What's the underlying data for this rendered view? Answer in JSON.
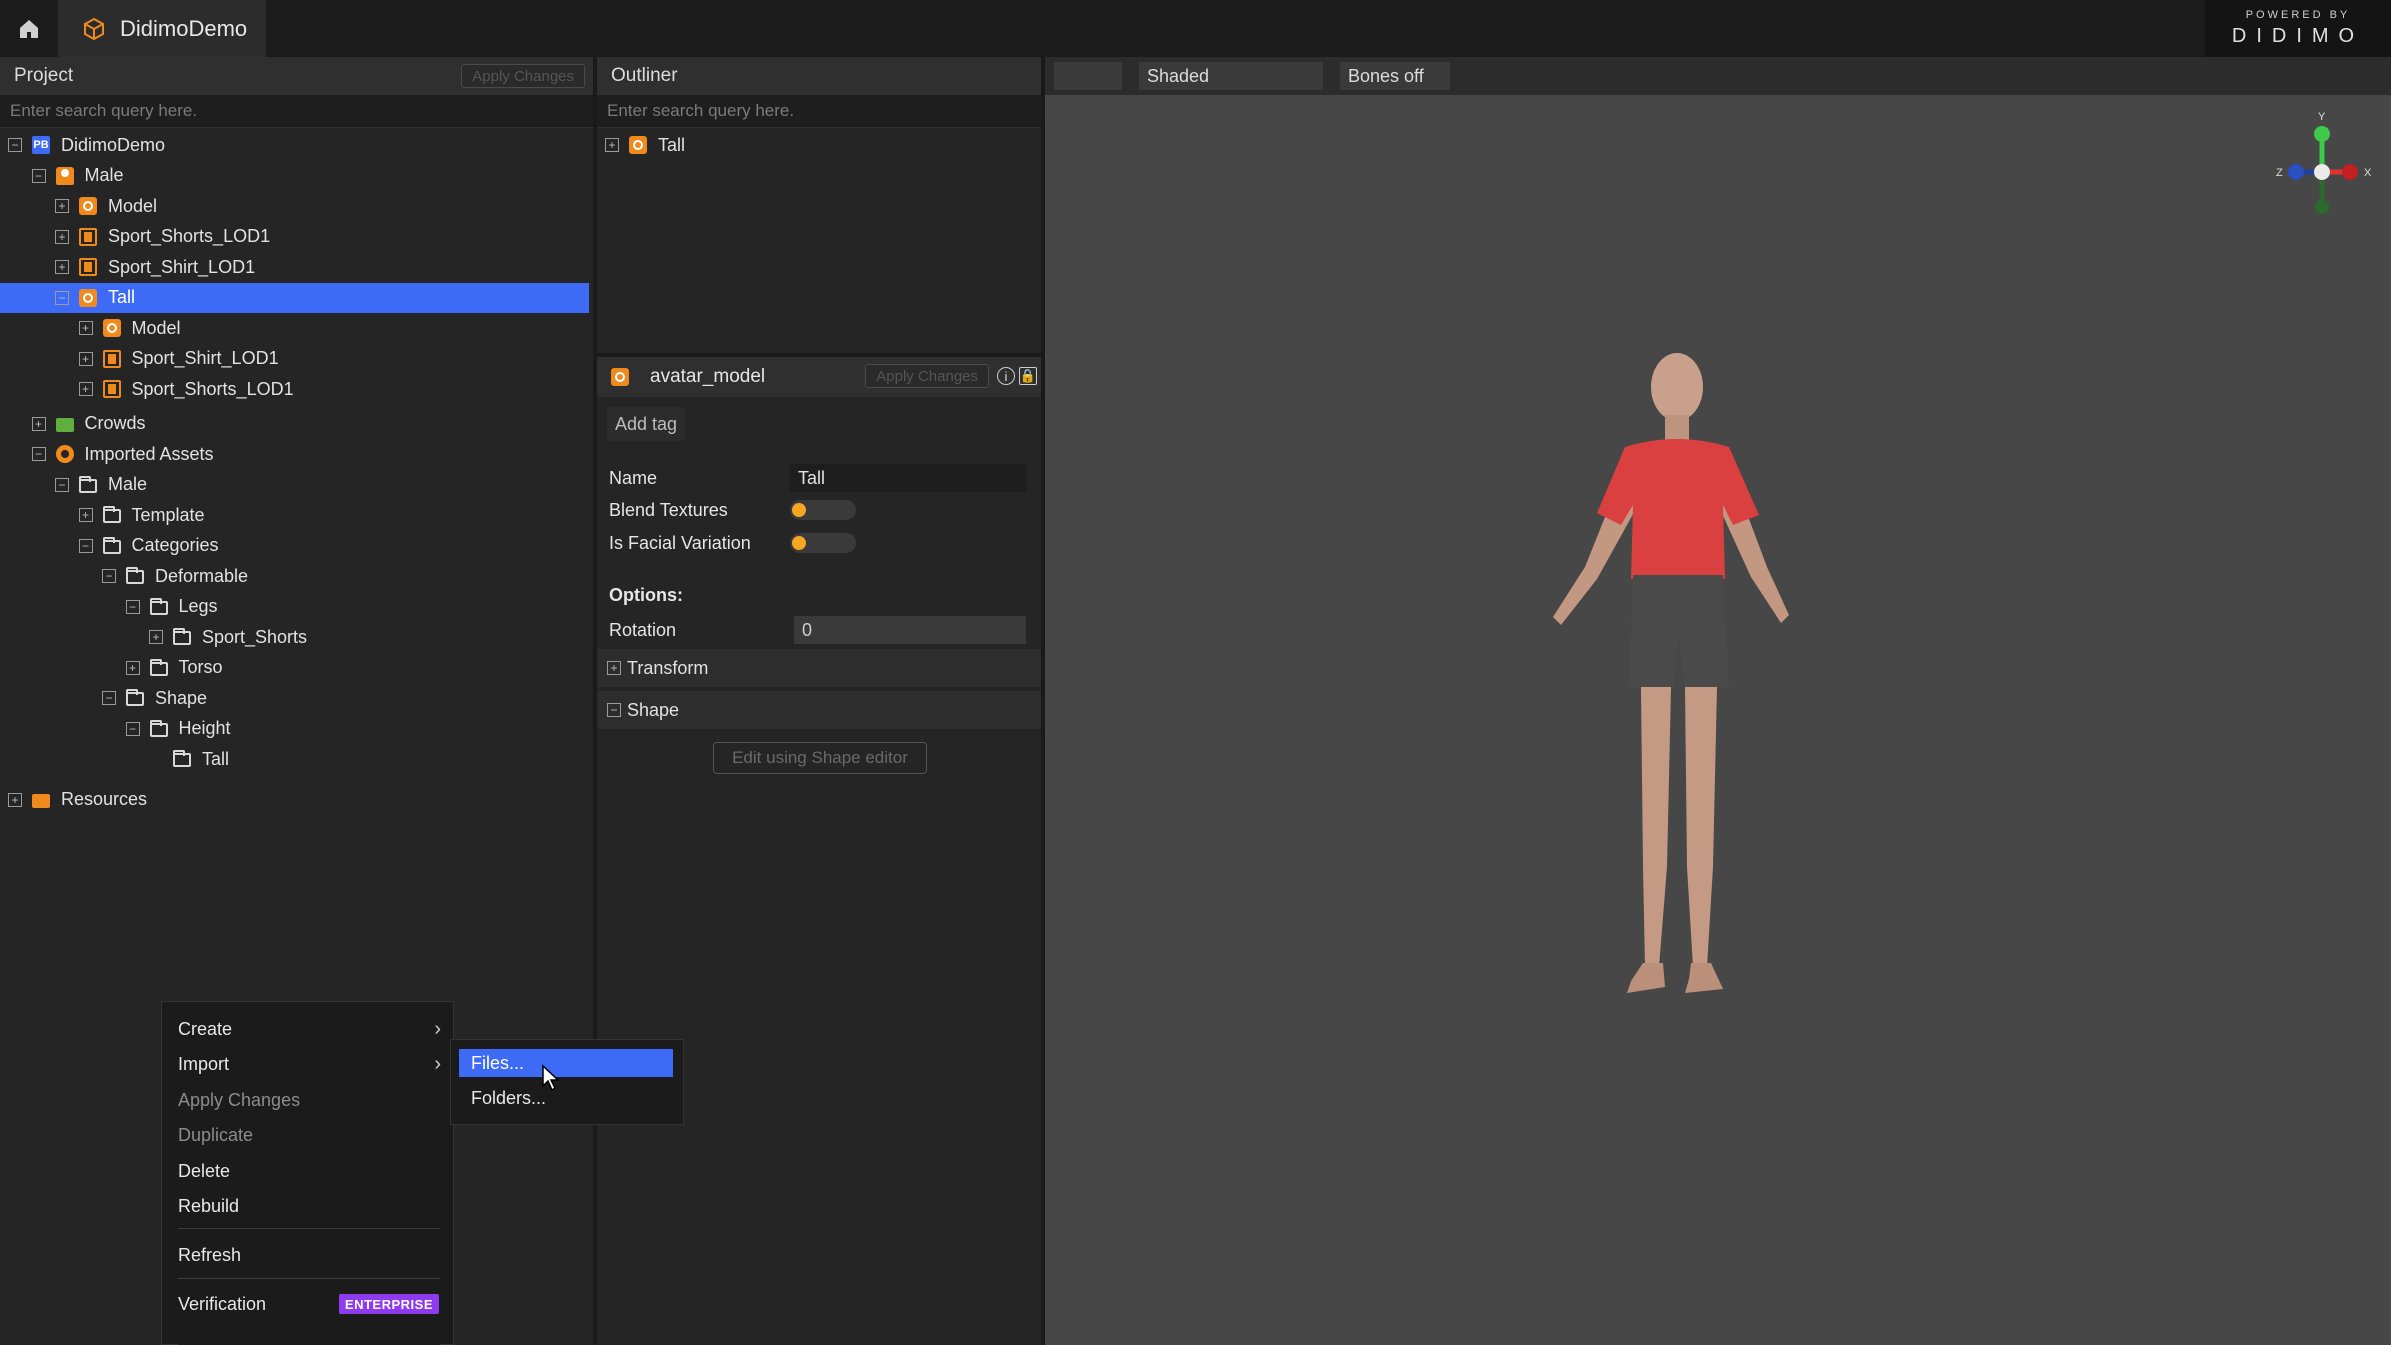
{
  "app": {
    "tab_title": "DidimoDemo",
    "logo_small": "POWERED BY",
    "logo_big": "DIDIMO"
  },
  "colors": {
    "accent_blue": "#3d6bf5",
    "accent_orange": "#f08a1c",
    "enterprise_purple": "#8e3bf0"
  },
  "project": {
    "title": "Project",
    "apply_label": "Apply Changes",
    "search_placeholder": "Enter search query here.",
    "tree": [
      {
        "label": "DidimoDemo",
        "depth": 0,
        "expander": "minus",
        "icon": "project-icon"
      },
      {
        "label": "Male",
        "depth": 1,
        "expander": "minus",
        "icon": "person-icon"
      },
      {
        "label": "Model",
        "depth": 2,
        "expander": "plus",
        "icon": "avatar-icon"
      },
      {
        "label": "Sport_Shorts_LOD1",
        "depth": 2,
        "expander": "plus",
        "icon": "garment-icon"
      },
      {
        "label": "Sport_Shirt_LOD1",
        "depth": 2,
        "expander": "plus",
        "icon": "garment-icon"
      },
      {
        "label": "Tall",
        "depth": 2,
        "expander": "minus",
        "icon": "avatar-icon",
        "selected": true
      },
      {
        "label": "Model",
        "depth": 3,
        "expander": "plus",
        "icon": "avatar-icon"
      },
      {
        "label": "Sport_Shirt_LOD1",
        "depth": 3,
        "expander": "plus",
        "icon": "garment-icon"
      },
      {
        "label": "Sport_Shorts_LOD1",
        "depth": 3,
        "expander": "plus",
        "icon": "garment-icon"
      },
      {
        "label": "Crowds",
        "depth": 1,
        "expander": "plus",
        "icon": "folder-green-icon"
      },
      {
        "label": "Imported Assets",
        "depth": 1,
        "expander": "minus",
        "icon": "imported-icon"
      },
      {
        "label": "Male",
        "depth": 2,
        "expander": "minus",
        "icon": "folder-icon"
      },
      {
        "label": "Template",
        "depth": 3,
        "expander": "plus",
        "icon": "folder-icon"
      },
      {
        "label": "Categories",
        "depth": 3,
        "expander": "minus",
        "icon": "folder-icon"
      },
      {
        "label": "Deformable",
        "depth": 4,
        "expander": "minus",
        "icon": "folder-icon"
      },
      {
        "label": "Legs",
        "depth": 5,
        "expander": "minus",
        "icon": "folder-icon"
      },
      {
        "label": "Sport_Shorts",
        "depth": 6,
        "expander": "plus",
        "icon": "folder-icon"
      },
      {
        "label": "Torso",
        "depth": 5,
        "expander": "plus",
        "icon": "folder-icon"
      },
      {
        "label": "Shape",
        "depth": 4,
        "expander": "minus",
        "icon": "folder-icon"
      },
      {
        "label": "Height",
        "depth": 5,
        "expander": "minus",
        "icon": "folder-icon"
      },
      {
        "label": "Tall",
        "depth": 6,
        "expander": "none",
        "icon": "folder-icon"
      },
      {
        "label": "Resources",
        "depth": 0,
        "expander": "plus",
        "icon": "folder-orange-icon"
      }
    ]
  },
  "outliner": {
    "title": "Outliner",
    "search_placeholder": "Enter search query here.",
    "items": [
      {
        "label": "Tall",
        "icon": "avatar-icon"
      }
    ]
  },
  "properties": {
    "title": "avatar_model",
    "apply_label": "Apply Changes",
    "add_tag": "Add tag",
    "name_label": "Name",
    "name_value": "Tall",
    "blend_textures_label": "Blend Textures",
    "facial_variation_label": "Is Facial Variation",
    "options_label": "Options:",
    "rotation_label": "Rotation",
    "rotation_value": "0",
    "transform_label": "Transform",
    "shape_label": "Shape",
    "shape_editor_button": "Edit using Shape editor"
  },
  "viewport": {
    "camera_value": "",
    "shading": "Shaded",
    "bones": "Bones off",
    "gizmo": {
      "x": "X",
      "y": "Y",
      "z": "Z"
    }
  },
  "context_menu": {
    "items": {
      "create": "Create",
      "import": "Import",
      "apply_changes": "Apply Changes",
      "duplicate": "Duplicate",
      "delete": "Delete",
      "rebuild": "Rebuild",
      "refresh": "Refresh",
      "verification": "Verification"
    },
    "enterprise_badge": "ENTERPRISE",
    "submenu": {
      "files": "Files...",
      "folders": "Folders..."
    }
  }
}
